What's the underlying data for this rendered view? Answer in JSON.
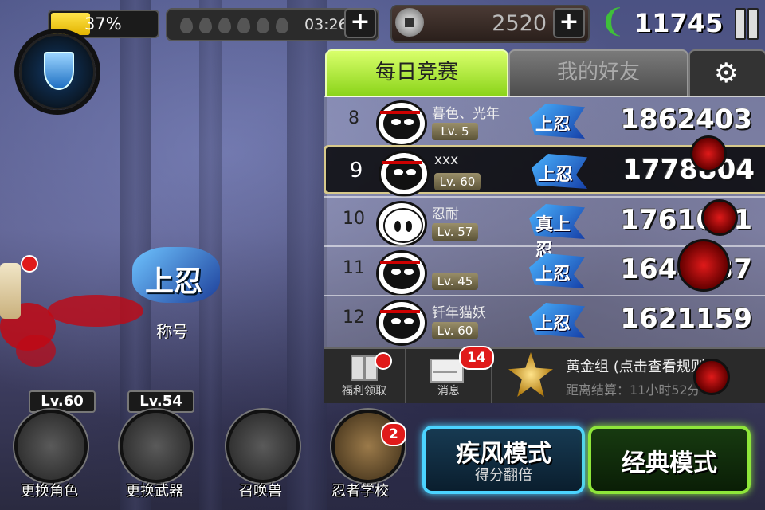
{
  "hud": {
    "hp_percent_label": "37%",
    "hp_fill_percent": 37,
    "energy_timer": "03:26",
    "plus_label": "+",
    "coins": "2520",
    "souls": "11745"
  },
  "leaderboard": {
    "tabs": [
      {
        "label": "每日竞赛",
        "active": true
      },
      {
        "label": "我的好友",
        "active": false
      }
    ],
    "settings_icon": "gear-icon",
    "rows": [
      {
        "rank": "8",
        "name": "暮色、光年",
        "level": "Lv. 5",
        "badge": "上忍",
        "score": "1862403",
        "avatar": "ninja"
      },
      {
        "rank": "9",
        "name": "xxx",
        "level": "Lv. 60",
        "badge": "上忍",
        "score": "1778804",
        "avatar": "ninja",
        "highlight": true
      },
      {
        "rank": "10",
        "name": "忍耐",
        "level": "Lv. 57",
        "badge": "真上忍",
        "score": "1761621",
        "avatar": "ghost"
      },
      {
        "rank": "11",
        "name": "",
        "level": "Lv. 45",
        "badge": "上忍",
        "score": "1644437",
        "avatar": "ninja"
      },
      {
        "rank": "12",
        "name": "钎年猫妖",
        "level": "Lv. 60",
        "badge": "上忍",
        "score": "1621159",
        "avatar": "ninja"
      }
    ],
    "bottom": {
      "welfare_label": "福利领取",
      "message_label": "消息",
      "message_count": "14",
      "group_title": "黄金组 (点击查看规则)",
      "group_sub": "距离结算：11小时52分"
    }
  },
  "left_menu": {
    "title_badge": "上忍",
    "title_label": "称号",
    "change_character": "更换角色",
    "change_weapon": "更换武器",
    "summon_beast": "召唤兽",
    "ninja_school": "忍者学校",
    "ninja_school_badge": "2",
    "char_level": "Lv.60",
    "weapon_level": "Lv.54"
  },
  "modes": {
    "storm_title": "疾风模式",
    "storm_sub": "得分翻倍",
    "classic_title": "经典模式"
  },
  "colors": {
    "hp_fill": "#e3b400",
    "tab_active": "#8bd41a",
    "storm_border": "#4bd3ff",
    "classic_border": "#8ee63a",
    "badge_red": "#e01a1a"
  }
}
